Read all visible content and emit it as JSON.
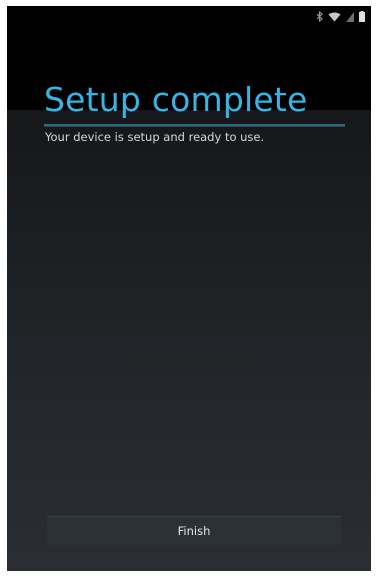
{
  "status_bar": {
    "icons": [
      "bluetooth-icon",
      "wifi-icon",
      "battery-icon"
    ]
  },
  "setup": {
    "title": "Setup complete",
    "message": "Your device is setup and ready to use.",
    "finish_label": "Finish"
  },
  "colors": {
    "accent": "#33b5e5",
    "header_background": "#000000",
    "body_background_top": "#151719",
    "body_background_bottom": "#2a2e32",
    "button_background": "#2c3135",
    "text": "#d6d6d6"
  }
}
